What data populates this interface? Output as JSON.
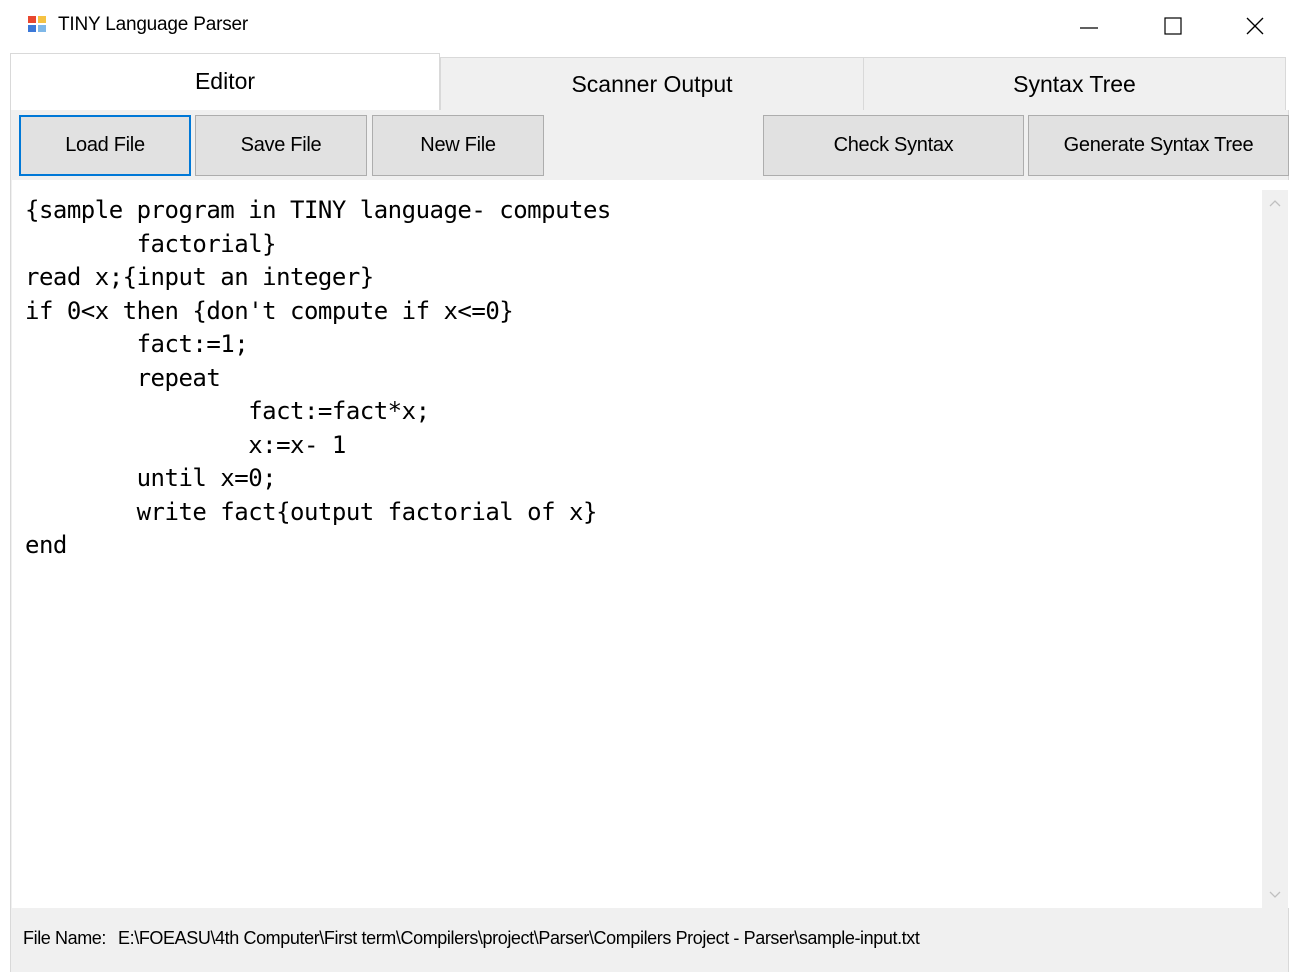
{
  "window": {
    "title": "TINY Language Parser",
    "icon": "app-window-icon"
  },
  "tabs": [
    {
      "label": "Editor",
      "selected": true
    },
    {
      "label": "Scanner Output",
      "selected": false
    },
    {
      "label": "Syntax Tree",
      "selected": false
    }
  ],
  "toolbar": {
    "load_label": "Load File",
    "save_label": "Save File",
    "new_label": "New File",
    "check_label": "Check Syntax",
    "generate_label": "Generate Syntax Tree"
  },
  "editor": {
    "content": "{sample program in TINY language- computes\n        factorial}\nread x;{input an integer}\nif 0<x then {don't compute if x<=0}\n        fact:=1;\n        repeat\n                fact:=fact*x;\n                x:=x- 1\n        until x=0;\n        write fact{output factorial of x}\nend"
  },
  "status": {
    "label": "File Name:",
    "path": "E:\\FOEASU\\4th Computer\\First term\\Compilers\\project\\Parser\\Compilers Project - Parser\\sample-input.txt"
  },
  "colors": {
    "focus_border": "#0078d7",
    "button_bg": "#e1e1e1",
    "panel_bg": "#f0f0f0"
  }
}
